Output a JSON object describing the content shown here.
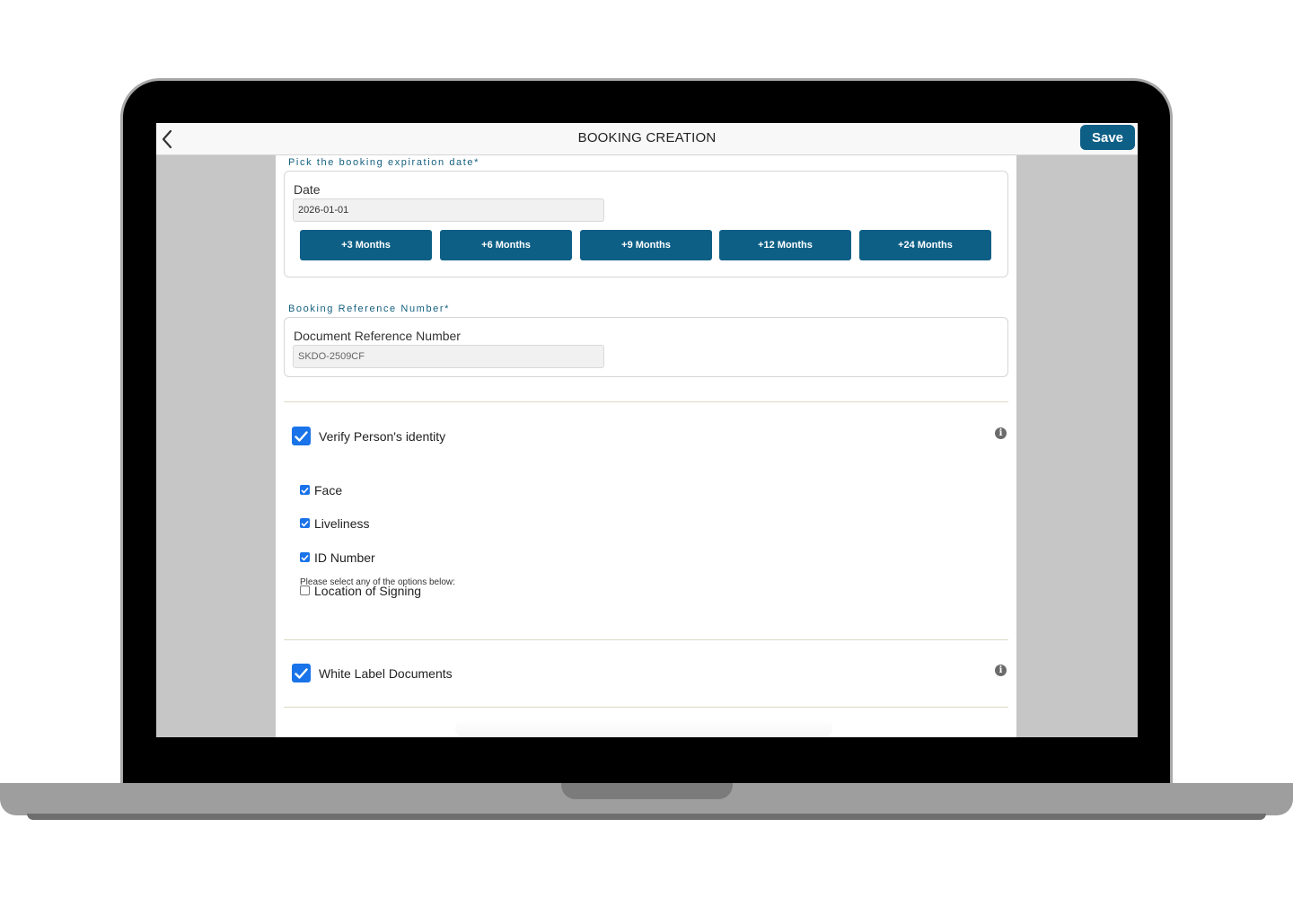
{
  "header": {
    "title": "BOOKING CREATION",
    "save_label": "Save"
  },
  "expiration": {
    "section_label": "Pick the booking expiration date*",
    "field_label": "Date",
    "value": "2026-01-01",
    "quick_buttons": [
      "+3 Months",
      "+6 Months",
      "+9 Months",
      "+12 Months",
      "+24 Months"
    ]
  },
  "reference": {
    "section_label": "Booking Reference Number*",
    "field_label": "Document Reference Number",
    "value": "SKDO-2509CF"
  },
  "verify": {
    "label": "Verify Person's identity",
    "checked": true,
    "helper": "Please select any of the options below:",
    "options": [
      {
        "label": "Face",
        "checked": true
      },
      {
        "label": "Liveliness",
        "checked": true
      },
      {
        "label": "ID Number",
        "checked": true
      },
      {
        "label": "Location of Signing",
        "checked": false
      }
    ]
  },
  "white_label": {
    "label": "White Label Documents",
    "checked": true
  },
  "colors": {
    "primary": "#0d5f86",
    "checkbox": "#1a73e8",
    "section_label": "#14607e",
    "divider": "#dcd9c4"
  },
  "icons": [
    "chevron-left-icon",
    "info-icon",
    "checkmark-icon"
  ]
}
